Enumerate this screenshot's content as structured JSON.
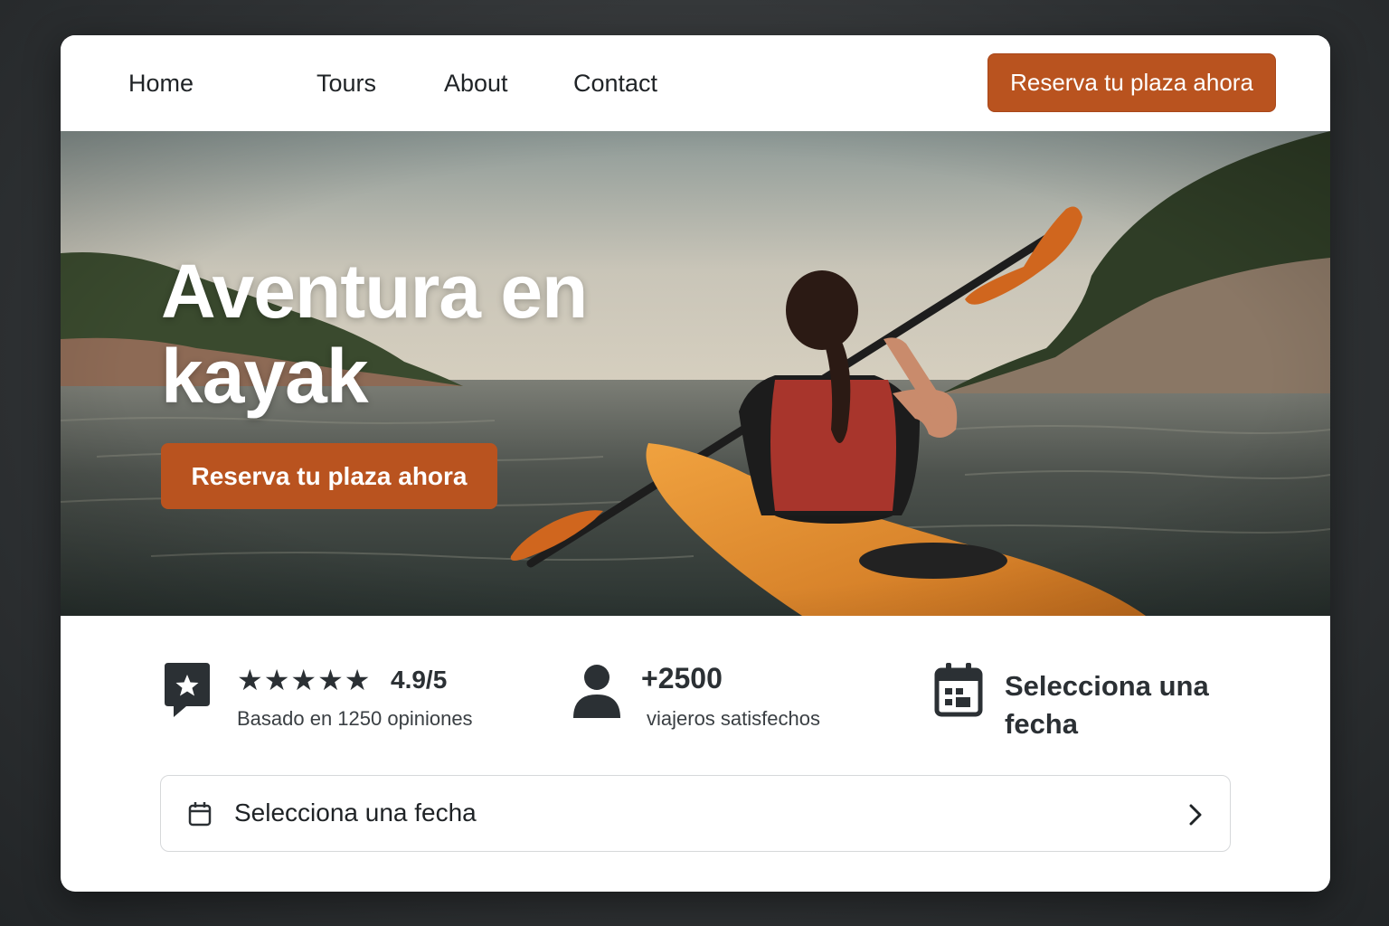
{
  "nav": {
    "links": [
      "Home",
      "Tours",
      "About",
      "Contact"
    ],
    "cta_label": "Reserva tu plaza ahora"
  },
  "hero": {
    "title": "Aventura en kayak",
    "cta_label": "Reserva tu plaza ahora",
    "image": "woman-paddling-orange-kayak-on-calm-sea"
  },
  "stats": {
    "rating": {
      "icon": "rating-badge-icon",
      "stars": 5,
      "value": "4.9/5",
      "caption": "Basado en 1250 opiniones"
    },
    "travelers": {
      "icon": "user-icon",
      "value": "+2500",
      "caption": "viajeros satisfechos"
    },
    "date": {
      "icon": "calendar-icon",
      "label": "Selecciona una fecha"
    }
  },
  "date_picker": {
    "icon": "calendar-icon",
    "label": "Selecciona una fecha",
    "chevron": "chevron-right-icon"
  },
  "colors": {
    "accent": "#b9531f",
    "text": "#1f2326",
    "icon": "#2b3034"
  }
}
